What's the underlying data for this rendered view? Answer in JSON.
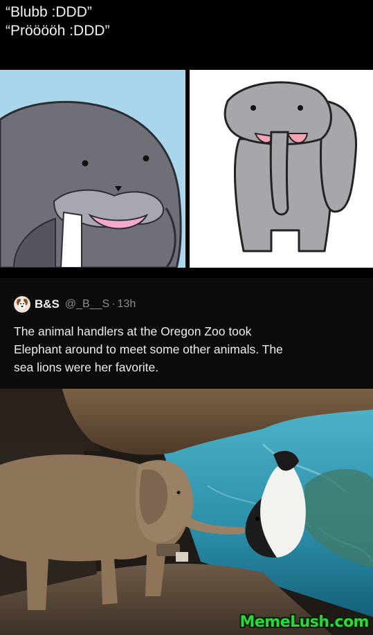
{
  "caption": {
    "line1": "“Blubb :DDD”",
    "line2": "“Prööööh :DDD”"
  },
  "drawings": {
    "left": {
      "depicts": "walrus-drawing",
      "background": "#a9d6ea"
    },
    "right": {
      "depicts": "elephant-drawing",
      "background": "#ffffff"
    }
  },
  "tweet": {
    "avatar_icon": "dog-avatar-icon",
    "author": "B&S",
    "handle": "@_B__S",
    "separator": "·",
    "time": "13h",
    "text_lines": [
      "The animal handlers at the Oregon Zoo took",
      "Elephant around to meet some other animals. The",
      "sea lions were her favorite."
    ]
  },
  "photo": {
    "depicts": "elephant-watching-sea-lion-photo"
  },
  "watermark": "MemeLush.com",
  "colors": {
    "background": "#000000",
    "tweet_bg": "#0b0b0c",
    "watermark": "#2fd63a"
  }
}
